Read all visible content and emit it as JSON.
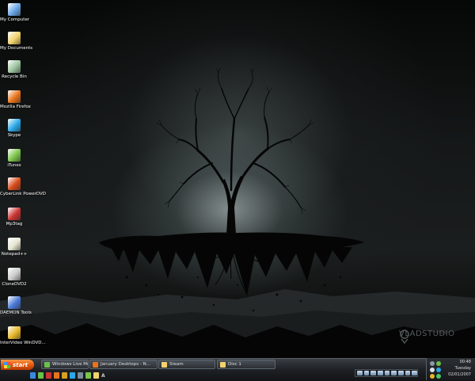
{
  "desktop": {
    "icons": [
      {
        "label": "My Computer",
        "icon": "computer-icon",
        "color": "#6aa6e8"
      },
      {
        "label": "My Documents",
        "icon": "documents-folder-icon",
        "color": "#f2d36b"
      },
      {
        "label": "Recycle Bin",
        "icon": "recycle-bin-icon",
        "color": "#9cc4a0"
      },
      {
        "label": "Mozilla Firefox",
        "icon": "firefox-icon",
        "color": "#e8731c"
      },
      {
        "label": "Skype",
        "icon": "skype-icon",
        "color": "#2aa8e8"
      },
      {
        "label": "iTunes",
        "icon": "itunes-icon",
        "color": "#7bc44a"
      },
      {
        "label": "CyberLink PowerDVD",
        "icon": "powerdvd-icon",
        "color": "#d84a1a"
      },
      {
        "label": "Mp3tag",
        "icon": "mp3tag-icon",
        "color": "#cc3333"
      },
      {
        "label": "Notepad++",
        "icon": "notepad-plus-icon",
        "color": "#e6e6d2"
      },
      {
        "label": "CloneDVD2",
        "icon": "clonedvd-icon",
        "color": "#cccccc"
      },
      {
        "label": "DAEMON Tools",
        "icon": "daemon-tools-icon",
        "color": "#4a7ad8"
      },
      {
        "label": "InterVideo WinDVD...",
        "icon": "windvd-icon",
        "color": "#e8b82a"
      }
    ],
    "watermark": "VLADSTUDIO"
  },
  "taskbar": {
    "start_label": "start",
    "tasks": [
      {
        "label": "Windows Live Messen...",
        "icon": "messenger-icon",
        "color": "#6cc04a"
      },
      {
        "label": "January Desktops - N...",
        "icon": "firefox-icon",
        "color": "#e8731c"
      },
      {
        "label": "Steam",
        "icon": "folder-icon",
        "color": "#f2d36b"
      },
      {
        "label": "Disc 1",
        "icon": "folder-icon",
        "color": "#f2d36b"
      }
    ],
    "quick_launch": [
      {
        "icon": "ie-icon",
        "color": "#3a8ae0"
      },
      {
        "icon": "messenger-icon",
        "color": "#6cc04a"
      },
      {
        "icon": "mp3tag-icon",
        "color": "#cc3333"
      },
      {
        "icon": "firefox-icon",
        "color": "#e8731c"
      },
      {
        "icon": "winamp-icon",
        "color": "#d8a020"
      },
      {
        "icon": "skype-icon",
        "color": "#2aa8e8"
      },
      {
        "icon": "steam-icon",
        "color": "#7a8a9a"
      },
      {
        "icon": "itunes-icon",
        "color": "#7bc44a"
      },
      {
        "icon": "explorer-icon",
        "color": "#f2d36b"
      }
    ],
    "quick_launch_text": "A",
    "tray": {
      "time": "00:48",
      "day": "Tuesday",
      "date": "02/01/2007"
    }
  }
}
